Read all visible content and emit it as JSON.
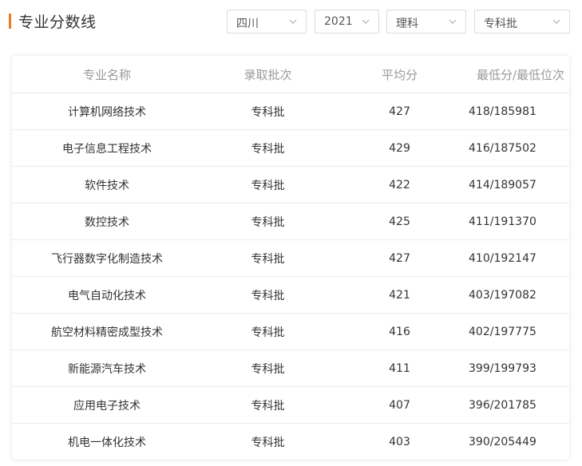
{
  "header": {
    "title": "专业分数线"
  },
  "filters": {
    "province": "四川",
    "year": "2021",
    "subject": "理科",
    "batch": "专科批"
  },
  "table": {
    "columns": [
      "专业名称",
      "录取批次",
      "平均分",
      "最低分/最低位次"
    ],
    "rows": [
      {
        "major": "计算机网络技术",
        "batch": "专科批",
        "avg": "427",
        "min": "418/185981"
      },
      {
        "major": "电子信息工程技术",
        "batch": "专科批",
        "avg": "429",
        "min": "416/187502"
      },
      {
        "major": "软件技术",
        "batch": "专科批",
        "avg": "422",
        "min": "414/189057"
      },
      {
        "major": "数控技术",
        "batch": "专科批",
        "avg": "425",
        "min": "411/191370"
      },
      {
        "major": "飞行器数字化制造技术",
        "batch": "专科批",
        "avg": "427",
        "min": "410/192147"
      },
      {
        "major": "电气自动化技术",
        "batch": "专科批",
        "avg": "421",
        "min": "403/197082"
      },
      {
        "major": "航空材料精密成型技术",
        "batch": "专科批",
        "avg": "416",
        "min": "402/197775"
      },
      {
        "major": "新能源汽车技术",
        "batch": "专科批",
        "avg": "411",
        "min": "399/199793"
      },
      {
        "major": "应用电子技术",
        "batch": "专科批",
        "avg": "407",
        "min": "396/201785"
      },
      {
        "major": "机电一体化技术",
        "batch": "专科批",
        "avg": "403",
        "min": "390/205449"
      }
    ]
  },
  "colors": {
    "accent": "#f07a23"
  }
}
